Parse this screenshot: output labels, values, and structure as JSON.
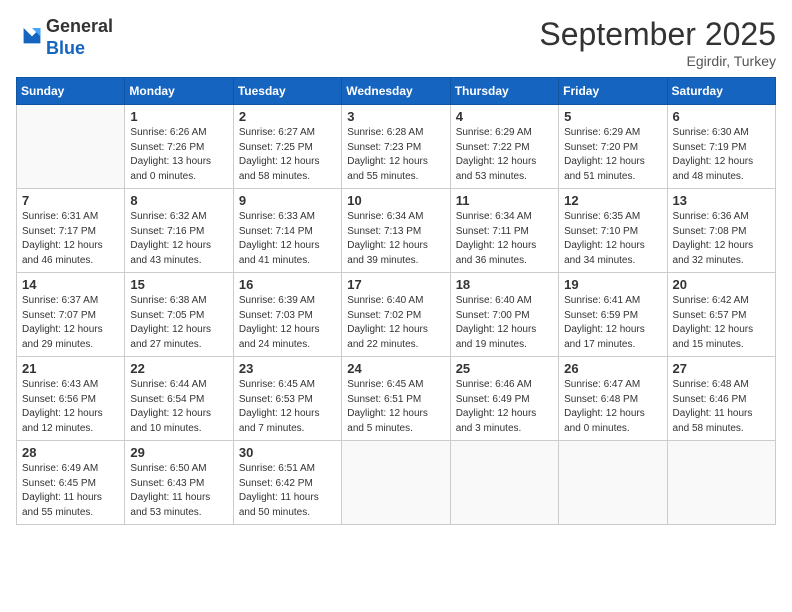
{
  "header": {
    "logo_line1": "General",
    "logo_line2": "Blue",
    "month": "September 2025",
    "location": "Egirdir, Turkey"
  },
  "days_of_week": [
    "Sunday",
    "Monday",
    "Tuesday",
    "Wednesday",
    "Thursday",
    "Friday",
    "Saturday"
  ],
  "weeks": [
    [
      {
        "day": "",
        "info": ""
      },
      {
        "day": "1",
        "info": "Sunrise: 6:26 AM\nSunset: 7:26 PM\nDaylight: 13 hours\nand 0 minutes."
      },
      {
        "day": "2",
        "info": "Sunrise: 6:27 AM\nSunset: 7:25 PM\nDaylight: 12 hours\nand 58 minutes."
      },
      {
        "day": "3",
        "info": "Sunrise: 6:28 AM\nSunset: 7:23 PM\nDaylight: 12 hours\nand 55 minutes."
      },
      {
        "day": "4",
        "info": "Sunrise: 6:29 AM\nSunset: 7:22 PM\nDaylight: 12 hours\nand 53 minutes."
      },
      {
        "day": "5",
        "info": "Sunrise: 6:29 AM\nSunset: 7:20 PM\nDaylight: 12 hours\nand 51 minutes."
      },
      {
        "day": "6",
        "info": "Sunrise: 6:30 AM\nSunset: 7:19 PM\nDaylight: 12 hours\nand 48 minutes."
      }
    ],
    [
      {
        "day": "7",
        "info": "Sunrise: 6:31 AM\nSunset: 7:17 PM\nDaylight: 12 hours\nand 46 minutes."
      },
      {
        "day": "8",
        "info": "Sunrise: 6:32 AM\nSunset: 7:16 PM\nDaylight: 12 hours\nand 43 minutes."
      },
      {
        "day": "9",
        "info": "Sunrise: 6:33 AM\nSunset: 7:14 PM\nDaylight: 12 hours\nand 41 minutes."
      },
      {
        "day": "10",
        "info": "Sunrise: 6:34 AM\nSunset: 7:13 PM\nDaylight: 12 hours\nand 39 minutes."
      },
      {
        "day": "11",
        "info": "Sunrise: 6:34 AM\nSunset: 7:11 PM\nDaylight: 12 hours\nand 36 minutes."
      },
      {
        "day": "12",
        "info": "Sunrise: 6:35 AM\nSunset: 7:10 PM\nDaylight: 12 hours\nand 34 minutes."
      },
      {
        "day": "13",
        "info": "Sunrise: 6:36 AM\nSunset: 7:08 PM\nDaylight: 12 hours\nand 32 minutes."
      }
    ],
    [
      {
        "day": "14",
        "info": "Sunrise: 6:37 AM\nSunset: 7:07 PM\nDaylight: 12 hours\nand 29 minutes."
      },
      {
        "day": "15",
        "info": "Sunrise: 6:38 AM\nSunset: 7:05 PM\nDaylight: 12 hours\nand 27 minutes."
      },
      {
        "day": "16",
        "info": "Sunrise: 6:39 AM\nSunset: 7:03 PM\nDaylight: 12 hours\nand 24 minutes."
      },
      {
        "day": "17",
        "info": "Sunrise: 6:40 AM\nSunset: 7:02 PM\nDaylight: 12 hours\nand 22 minutes."
      },
      {
        "day": "18",
        "info": "Sunrise: 6:40 AM\nSunset: 7:00 PM\nDaylight: 12 hours\nand 19 minutes."
      },
      {
        "day": "19",
        "info": "Sunrise: 6:41 AM\nSunset: 6:59 PM\nDaylight: 12 hours\nand 17 minutes."
      },
      {
        "day": "20",
        "info": "Sunrise: 6:42 AM\nSunset: 6:57 PM\nDaylight: 12 hours\nand 15 minutes."
      }
    ],
    [
      {
        "day": "21",
        "info": "Sunrise: 6:43 AM\nSunset: 6:56 PM\nDaylight: 12 hours\nand 12 minutes."
      },
      {
        "day": "22",
        "info": "Sunrise: 6:44 AM\nSunset: 6:54 PM\nDaylight: 12 hours\nand 10 minutes."
      },
      {
        "day": "23",
        "info": "Sunrise: 6:45 AM\nSunset: 6:53 PM\nDaylight: 12 hours\nand 7 minutes."
      },
      {
        "day": "24",
        "info": "Sunrise: 6:45 AM\nSunset: 6:51 PM\nDaylight: 12 hours\nand 5 minutes."
      },
      {
        "day": "25",
        "info": "Sunrise: 6:46 AM\nSunset: 6:49 PM\nDaylight: 12 hours\nand 3 minutes."
      },
      {
        "day": "26",
        "info": "Sunrise: 6:47 AM\nSunset: 6:48 PM\nDaylight: 12 hours\nand 0 minutes."
      },
      {
        "day": "27",
        "info": "Sunrise: 6:48 AM\nSunset: 6:46 PM\nDaylight: 11 hours\nand 58 minutes."
      }
    ],
    [
      {
        "day": "28",
        "info": "Sunrise: 6:49 AM\nSunset: 6:45 PM\nDaylight: 11 hours\nand 55 minutes."
      },
      {
        "day": "29",
        "info": "Sunrise: 6:50 AM\nSunset: 6:43 PM\nDaylight: 11 hours\nand 53 minutes."
      },
      {
        "day": "30",
        "info": "Sunrise: 6:51 AM\nSunset: 6:42 PM\nDaylight: 11 hours\nand 50 minutes."
      },
      {
        "day": "",
        "info": ""
      },
      {
        "day": "",
        "info": ""
      },
      {
        "day": "",
        "info": ""
      },
      {
        "day": "",
        "info": ""
      }
    ]
  ]
}
